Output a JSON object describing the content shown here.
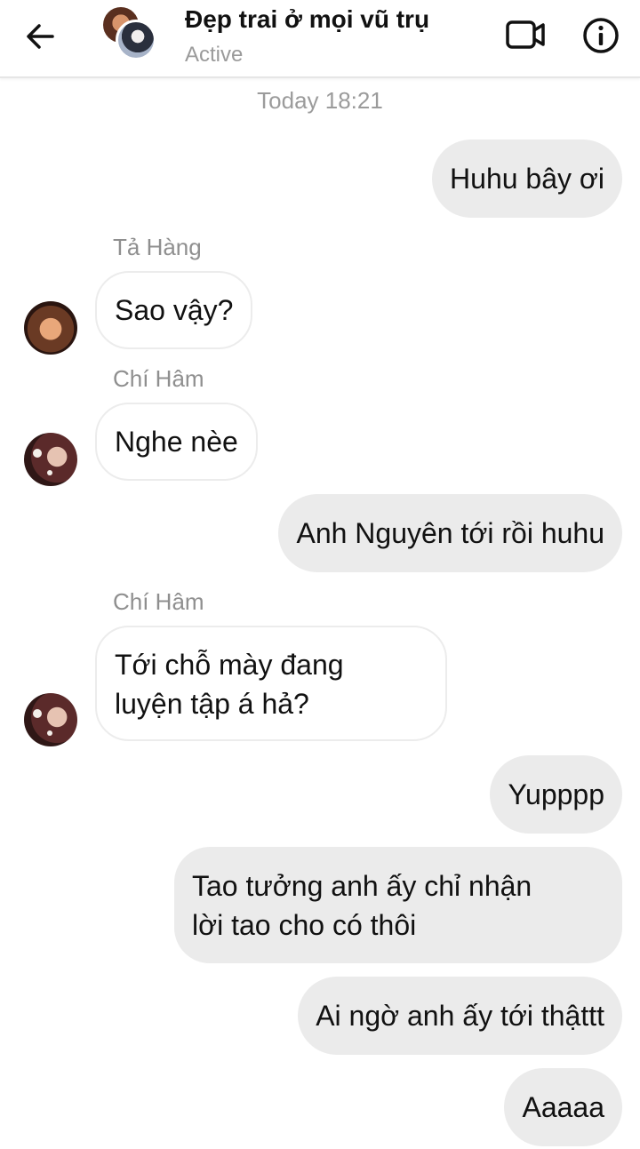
{
  "header": {
    "title": "Đẹp trai ở mọi vũ trụ",
    "status": "Active",
    "back_icon": "arrow-left-icon",
    "video_icon": "video-camera-icon",
    "info_icon": "info-circle-icon"
  },
  "timestamp": "Today 18:21",
  "messages": [
    {
      "direction": "out",
      "text": "Huhu bây ơi"
    },
    {
      "direction": "in",
      "sender": "Tả Hàng",
      "text": "Sao vậy?"
    },
    {
      "direction": "in",
      "sender": "Chí Hâm",
      "text": "Nghe nèe"
    },
    {
      "direction": "out",
      "text": "Anh Nguyên tới rồi huhu"
    },
    {
      "direction": "in",
      "sender": "Chí Hâm",
      "text": "Tới chỗ mày đang\nluyện tập á hả?"
    },
    {
      "direction": "out",
      "text": "Yupppp"
    },
    {
      "direction": "out",
      "text": "Tao tưởng anh ấy chỉ nhận\nlời tao cho có thôi"
    },
    {
      "direction": "out",
      "text": "Ai ngờ anh ấy tới thậttt"
    },
    {
      "direction": "out",
      "text": "Aaaaa"
    }
  ],
  "colors": {
    "outgoing_bubble": "#ebebeb",
    "incoming_border": "#ececec",
    "secondary_text": "#9b9b9b"
  }
}
